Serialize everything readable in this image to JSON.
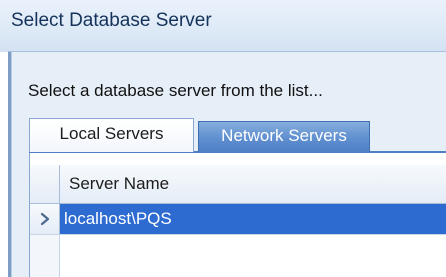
{
  "window": {
    "title": "Select Database Server"
  },
  "dialog": {
    "prompt": "Select a database server from the list..."
  },
  "tabs": [
    {
      "label": "Local Servers",
      "selected": true
    },
    {
      "label": "Network Servers",
      "selected": false
    }
  ],
  "grid": {
    "columns": [
      "Server Name"
    ],
    "rows": [
      {
        "server_name": "localhost\\PQS",
        "selected": true
      }
    ],
    "current_row_indicator_icon": "chevron-right-icon"
  },
  "colors": {
    "selection": "#2e6bd1",
    "inactive_tab": "#5f8fcf",
    "title_text": "#15325a"
  }
}
